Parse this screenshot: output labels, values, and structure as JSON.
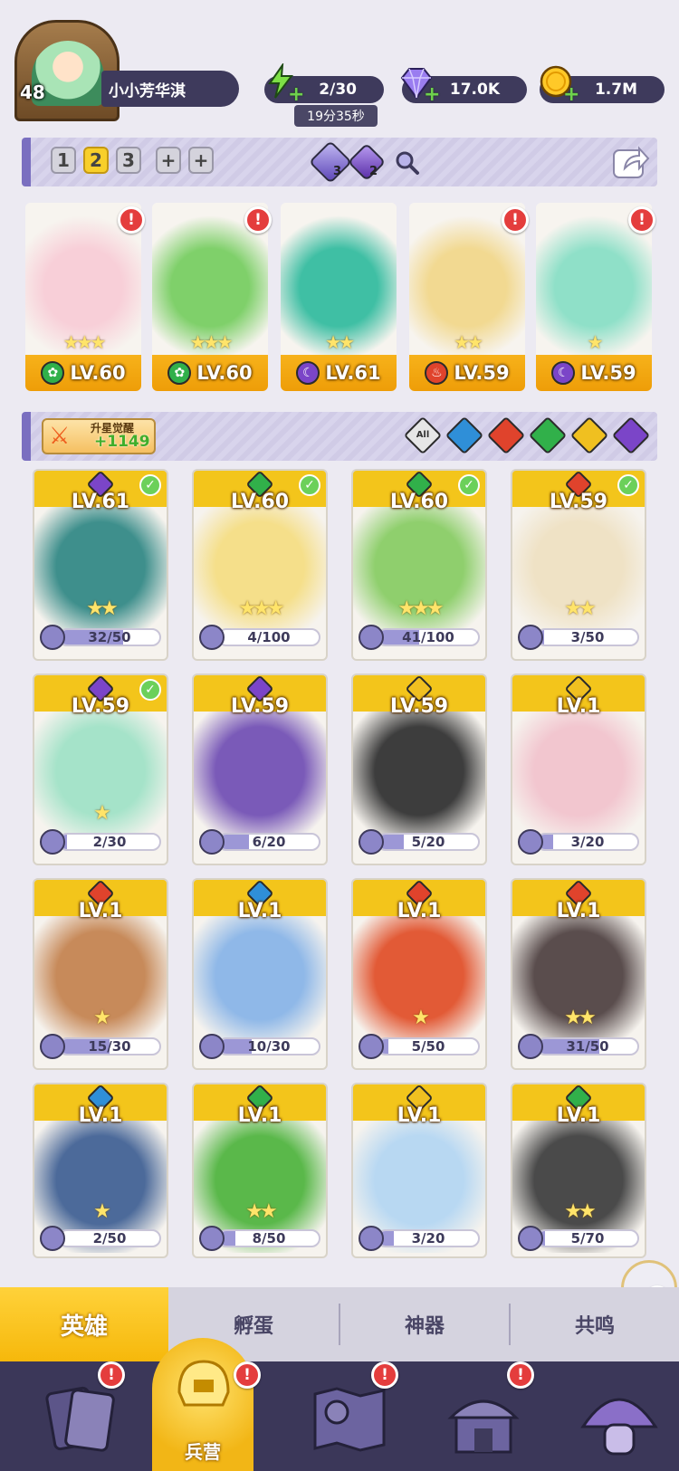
{
  "player": {
    "level": "48",
    "name": "小小芳华淇"
  },
  "resources": {
    "energy": {
      "value": "2/30",
      "timer": "19分35秒"
    },
    "gems": {
      "value": "17.0K"
    },
    "coins": {
      "value": "1.7M"
    }
  },
  "teams": {
    "tabs": [
      "1",
      "2",
      "3",
      "+",
      "+"
    ],
    "active_index": 1
  },
  "team_gems": {
    "item1_count": "3",
    "item2_count": "2"
  },
  "formation": [
    {
      "level": "LV.60",
      "stars": "★★★",
      "element": "grass",
      "alert": true,
      "color": "#f8cfd8"
    },
    {
      "level": "LV.60",
      "stars": "★★★",
      "element": "grass",
      "alert": true,
      "color": "#7fd06a"
    },
    {
      "level": "LV.61",
      "stars": "★★",
      "element": "dark",
      "alert": false,
      "color": "#3fbfa4"
    },
    {
      "level": "LV.59",
      "stars": "★★",
      "element": "fire",
      "alert": true,
      "color": "#f2d991"
    },
    {
      "level": "LV.59",
      "stars": "★",
      "element": "dark",
      "alert": true,
      "color": "#8fe0c8"
    }
  ],
  "awaken": {
    "label": "升星觉醒",
    "count": "+1149"
  },
  "filters": [
    {
      "label": "All",
      "color": "#e6e6e6"
    },
    {
      "label": "",
      "color": "#2f8fd8"
    },
    {
      "label": "",
      "color": "#e0432c"
    },
    {
      "label": "",
      "color": "#31b04a"
    },
    {
      "label": "",
      "color": "#f0c020"
    },
    {
      "label": "",
      "color": "#7b45c8"
    }
  ],
  "heroes": [
    {
      "level": "LV.61",
      "shards": "32/50",
      "progress": 0.64,
      "stars": "★★",
      "element": "#7b45c8",
      "checked": true,
      "art": "#3e8f8c"
    },
    {
      "level": "LV.60",
      "shards": "4/100",
      "progress": 0.04,
      "stars": "★★★",
      "element": "#31b04a",
      "checked": true,
      "art": "#f5df8a"
    },
    {
      "level": "LV.60",
      "shards": "41/100",
      "progress": 0.41,
      "stars": "★★★",
      "element": "#31b04a",
      "checked": true,
      "art": "#8fcf6d"
    },
    {
      "level": "LV.59",
      "shards": "3/50",
      "progress": 0.06,
      "stars": "★★",
      "element": "#e0432c",
      "checked": true,
      "art": "#efe2c5"
    },
    {
      "level": "LV.59",
      "shards": "2/30",
      "progress": 0.07,
      "stars": "★",
      "element": "#7b45c8",
      "checked": true,
      "art": "#a5e3c9"
    },
    {
      "level": "LV.59",
      "shards": "6/20",
      "progress": 0.3,
      "stars": "",
      "element": "#7b45c8",
      "checked": false,
      "art": "#7a5ab8"
    },
    {
      "level": "LV.59",
      "shards": "5/20",
      "progress": 0.25,
      "stars": "",
      "element": "#f0c020",
      "checked": false,
      "art": "#3d3d3d"
    },
    {
      "level": "LV.1",
      "shards": "3/20",
      "progress": 0.15,
      "stars": "",
      "element": "#f0c020",
      "checked": false,
      "art": "#f2c6cf"
    },
    {
      "level": "LV.1",
      "shards": "15/30",
      "progress": 0.5,
      "stars": "★",
      "element": "#e0432c",
      "checked": false,
      "art": "#c78a5a"
    },
    {
      "level": "LV.1",
      "shards": "10/30",
      "progress": 0.33,
      "stars": "",
      "element": "#2f8fd8",
      "checked": false,
      "art": "#8fb8e8"
    },
    {
      "level": "LV.1",
      "shards": "5/50",
      "progress": 0.1,
      "stars": "★",
      "element": "#e0432c",
      "checked": false,
      "art": "#e25a36"
    },
    {
      "level": "LV.1",
      "shards": "31/50",
      "progress": 0.62,
      "stars": "★★",
      "element": "#e0432c",
      "checked": false,
      "art": "#5a4d4d"
    },
    {
      "level": "LV.1",
      "shards": "2/50",
      "progress": 0.04,
      "stars": "★",
      "element": "#2f8fd8",
      "checked": false,
      "art": "#4c6a9a"
    },
    {
      "level": "LV.1",
      "shards": "8/50",
      "progress": 0.16,
      "stars": "★★",
      "element": "#31b04a",
      "checked": false,
      "art": "#5ab84a"
    },
    {
      "level": "LV.1",
      "shards": "3/20",
      "progress": 0.15,
      "stars": "",
      "element": "#f0c020",
      "checked": false,
      "art": "#b8d8f2"
    },
    {
      "level": "LV.1",
      "shards": "5/70",
      "progress": 0.07,
      "stars": "★★",
      "element": "#31b04a",
      "checked": false,
      "art": "#4a4a4a"
    }
  ],
  "subtabs": [
    "英雄",
    "孵蛋",
    "神器",
    "共鸣"
  ],
  "nav": {
    "active_label": "兵营"
  },
  "colors": {
    "accent": "#f6b80b",
    "panel": "#3b3759",
    "alert": "#e43d3d"
  }
}
